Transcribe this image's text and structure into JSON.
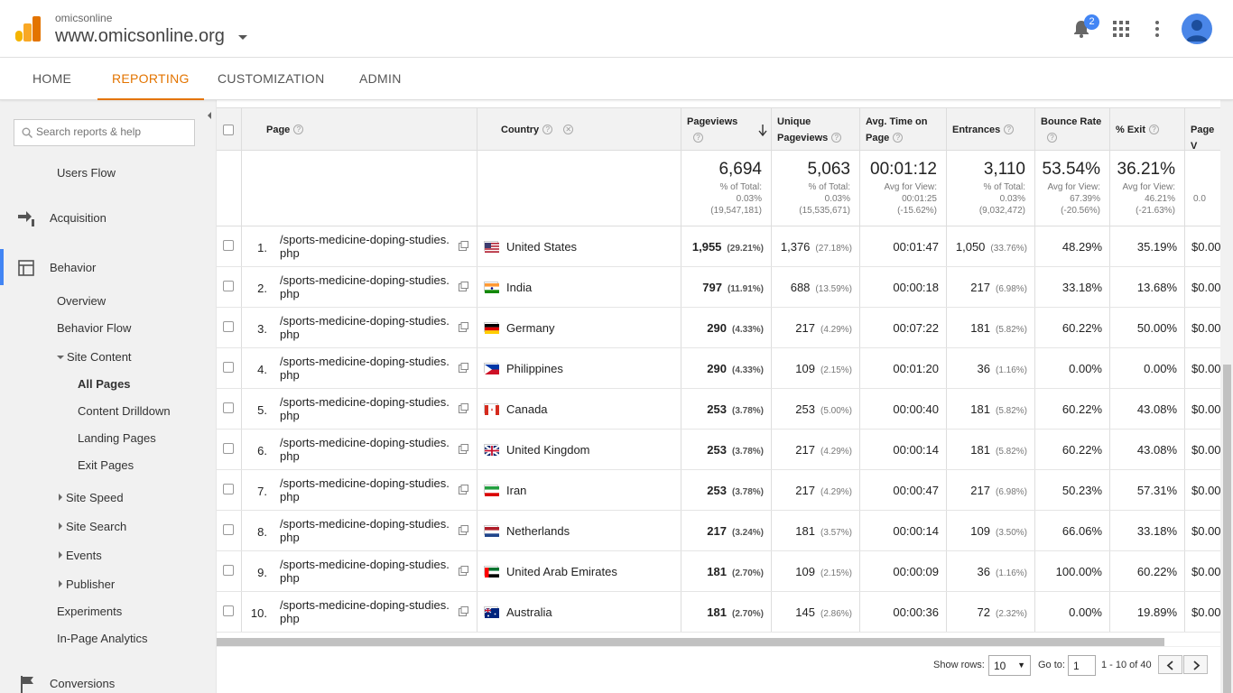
{
  "header": {
    "account_small": "omicsonline",
    "account_main": "www.omicsonline.org",
    "notification_count": "2"
  },
  "nav_tabs": [
    "HOME",
    "REPORTING",
    "CUSTOMIZATION",
    "ADMIN"
  ],
  "active_tab": "REPORTING",
  "sidebar": {
    "search_placeholder": "Search reports & help",
    "users_flow": "Users Flow",
    "acquisition": "Acquisition",
    "behavior": "Behavior",
    "overview": "Overview",
    "behavior_flow": "Behavior Flow",
    "site_content": "Site Content",
    "all_pages": "All Pages",
    "content_drilldown": "Content Drilldown",
    "landing_pages": "Landing Pages",
    "exit_pages": "Exit Pages",
    "site_speed": "Site Speed",
    "site_search": "Site Search",
    "events": "Events",
    "publisher": "Publisher",
    "experiments": "Experiments",
    "in_page_analytics": "In-Page Analytics",
    "conversions": "Conversions"
  },
  "table": {
    "headers": {
      "page": "Page",
      "country": "Country",
      "pageviews": "Pageviews",
      "unique_1": "Unique",
      "unique_2": "Pageviews",
      "avg_time_1": "Avg. Time on",
      "avg_time_2": "Page",
      "entrances": "Entrances",
      "bounce_rate": "Bounce Rate",
      "exit": "% Exit",
      "page_value": "Page V"
    },
    "summary": {
      "pageviews": "6,694",
      "pageviews_sub1": "% of Total:",
      "pageviews_sub2": "0.03%",
      "pageviews_sub3": "(19,547,181)",
      "unique": "5,063",
      "unique_sub1": "% of Total:",
      "unique_sub2": "0.03%",
      "unique_sub3": "(15,535,671)",
      "avg_time": "00:01:12",
      "avg_time_sub1": "Avg for View:",
      "avg_time_sub2": "00:01:25",
      "avg_time_sub3": "(-15.62%)",
      "entrances": "3,110",
      "entrances_sub1": "% of Total:",
      "entrances_sub2": "0.03%",
      "entrances_sub3": "(9,032,472)",
      "bounce": "53.54%",
      "bounce_sub1": "Avg for View:",
      "bounce_sub2": "67.39%",
      "bounce_sub3": "(-20.56%)",
      "exit": "36.21%",
      "exit_sub1": "Avg for View:",
      "exit_sub2": "46.21%",
      "exit_sub3": "(-21.63%)",
      "page_value_sub": "0.0"
    },
    "rows": [
      {
        "n": "1.",
        "page1": "/sports-medicine-doping-studies.",
        "page2": "php",
        "country": "United States",
        "pv": "1,955",
        "pv_pct": "(29.21%)",
        "upv": "1,376",
        "upv_pct": "(27.18%)",
        "avg": "00:01:47",
        "ent": "1,050",
        "ent_pct": "(33.76%)",
        "bounce": "48.29%",
        "exit": "35.19%",
        "value": "$0.00"
      },
      {
        "n": "2.",
        "page1": "/sports-medicine-doping-studies.",
        "page2": "php",
        "country": "India",
        "pv": "797",
        "pv_pct": "(11.91%)",
        "upv": "688",
        "upv_pct": "(13.59%)",
        "avg": "00:00:18",
        "ent": "217",
        "ent_pct": "(6.98%)",
        "bounce": "33.18%",
        "exit": "13.68%",
        "value": "$0.00"
      },
      {
        "n": "3.",
        "page1": "/sports-medicine-doping-studies.",
        "page2": "php",
        "country": "Germany",
        "pv": "290",
        "pv_pct": "(4.33%)",
        "upv": "217",
        "upv_pct": "(4.29%)",
        "avg": "00:07:22",
        "ent": "181",
        "ent_pct": "(5.82%)",
        "bounce": "60.22%",
        "exit": "50.00%",
        "value": "$0.00"
      },
      {
        "n": "4.",
        "page1": "/sports-medicine-doping-studies.",
        "page2": "php",
        "country": "Philippines",
        "pv": "290",
        "pv_pct": "(4.33%)",
        "upv": "109",
        "upv_pct": "(2.15%)",
        "avg": "00:01:20",
        "ent": "36",
        "ent_pct": "(1.16%)",
        "bounce": "0.00%",
        "exit": "0.00%",
        "value": "$0.00"
      },
      {
        "n": "5.",
        "page1": "/sports-medicine-doping-studies.",
        "page2": "php",
        "country": "Canada",
        "pv": "253",
        "pv_pct": "(3.78%)",
        "upv": "253",
        "upv_pct": "(5.00%)",
        "avg": "00:00:40",
        "ent": "181",
        "ent_pct": "(5.82%)",
        "bounce": "60.22%",
        "exit": "43.08%",
        "value": "$0.00"
      },
      {
        "n": "6.",
        "page1": "/sports-medicine-doping-studies.",
        "page2": "php",
        "country": "United Kingdom",
        "pv": "253",
        "pv_pct": "(3.78%)",
        "upv": "217",
        "upv_pct": "(4.29%)",
        "avg": "00:00:14",
        "ent": "181",
        "ent_pct": "(5.82%)",
        "bounce": "60.22%",
        "exit": "43.08%",
        "value": "$0.00"
      },
      {
        "n": "7.",
        "page1": "/sports-medicine-doping-studies.",
        "page2": "php",
        "country": "Iran",
        "pv": "253",
        "pv_pct": "(3.78%)",
        "upv": "217",
        "upv_pct": "(4.29%)",
        "avg": "00:00:47",
        "ent": "217",
        "ent_pct": "(6.98%)",
        "bounce": "50.23%",
        "exit": "57.31%",
        "value": "$0.00"
      },
      {
        "n": "8.",
        "page1": "/sports-medicine-doping-studies.",
        "page2": "php",
        "country": "Netherlands",
        "pv": "217",
        "pv_pct": "(3.24%)",
        "upv": "181",
        "upv_pct": "(3.57%)",
        "avg": "00:00:14",
        "ent": "109",
        "ent_pct": "(3.50%)",
        "bounce": "66.06%",
        "exit": "33.18%",
        "value": "$0.00"
      },
      {
        "n": "9.",
        "page1": "/sports-medicine-doping-studies.",
        "page2": "php",
        "country": "United Arab Emirates",
        "pv": "181",
        "pv_pct": "(2.70%)",
        "upv": "109",
        "upv_pct": "(2.15%)",
        "avg": "00:00:09",
        "ent": "36",
        "ent_pct": "(1.16%)",
        "bounce": "100.00%",
        "exit": "60.22%",
        "value": "$0.00"
      },
      {
        "n": "10.",
        "page1": "/sports-medicine-doping-studies.",
        "page2": "php",
        "country": "Australia",
        "pv": "181",
        "pv_pct": "(2.70%)",
        "upv": "145",
        "upv_pct": "(2.86%)",
        "avg": "00:00:36",
        "ent": "72",
        "ent_pct": "(2.32%)",
        "bounce": "0.00%",
        "exit": "19.89%",
        "value": "$0.00"
      }
    ],
    "flags": [
      "us-flag-icon",
      "india-flag-icon",
      "germany-flag-icon",
      "philippines-flag-icon",
      "canada-flag-icon",
      "uk-flag-icon",
      "iran-flag-icon",
      "netherlands-flag-icon",
      "uae-flag-icon",
      "australia-flag-icon"
    ]
  },
  "footer": {
    "show_rows_label": "Show rows:",
    "show_rows_value": "10",
    "goto_label": "Go to:",
    "goto_value": "1",
    "range": "1 - 10 of 40"
  },
  "colors": {
    "accent": "#e37400",
    "active_nav": "#4285f4"
  }
}
